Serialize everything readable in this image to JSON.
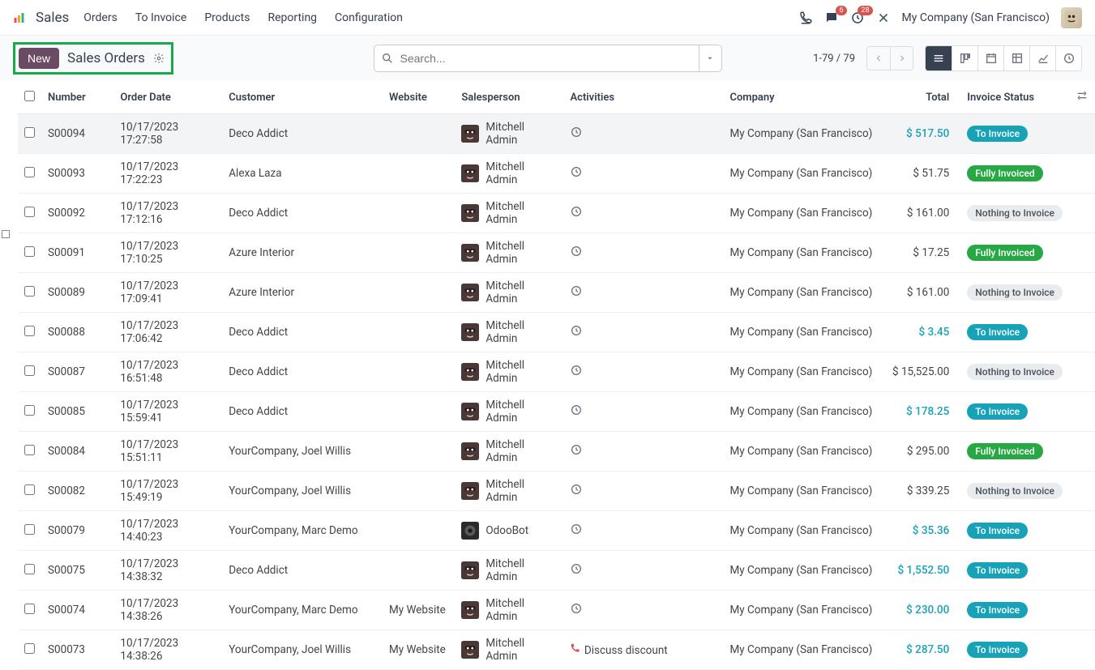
{
  "header": {
    "app_name": "Sales",
    "menu": [
      "Orders",
      "To Invoice",
      "Products",
      "Reporting",
      "Configuration"
    ],
    "msg_badge": "6",
    "activity_badge": "28",
    "company": "My Company (San Francisco)"
  },
  "controls": {
    "new_label": "New",
    "breadcrumb": "Sales Orders",
    "search_placeholder": "Search...",
    "pager": "1-79 / 79"
  },
  "columns": {
    "number": "Number",
    "order_date": "Order Date",
    "customer": "Customer",
    "website": "Website",
    "salesperson": "Salesperson",
    "activities": "Activities",
    "company": "Company",
    "total": "Total",
    "invoice_status": "Invoice Status"
  },
  "status_labels": {
    "to_invoice": "To Invoice",
    "fully": "Fully Invoiced",
    "nothing": "Nothing to Invoice"
  },
  "rows": [
    {
      "n": "S00094",
      "d": "10/17/2023 17:27:58",
      "c": "Deco Addict",
      "w": "",
      "sp": "Mitchell Admin",
      "spt": "m",
      "act": "clock",
      "actt": "",
      "co": "My Company (San Francisco)",
      "t": "$ 517.50",
      "tl": true,
      "s": "to_invoice",
      "hl": true
    },
    {
      "n": "S00093",
      "d": "10/17/2023 17:22:23",
      "c": "Alexa Laza",
      "w": "",
      "sp": "Mitchell Admin",
      "spt": "m",
      "act": "clock",
      "actt": "",
      "co": "My Company (San Francisco)",
      "t": "$ 51.75",
      "tl": false,
      "s": "fully",
      "hl": false
    },
    {
      "n": "S00092",
      "d": "10/17/2023 17:12:16",
      "c": "Deco Addict",
      "w": "",
      "sp": "Mitchell Admin",
      "spt": "m",
      "act": "clock",
      "actt": "",
      "co": "My Company (San Francisco)",
      "t": "$ 161.00",
      "tl": false,
      "s": "nothing",
      "hl": false
    },
    {
      "n": "S00091",
      "d": "10/17/2023 17:10:25",
      "c": "Azure Interior",
      "w": "",
      "sp": "Mitchell Admin",
      "spt": "m",
      "act": "clock",
      "actt": "",
      "co": "My Company (San Francisco)",
      "t": "$ 17.25",
      "tl": false,
      "s": "fully",
      "hl": false
    },
    {
      "n": "S00089",
      "d": "10/17/2023 17:09:41",
      "c": "Azure Interior",
      "w": "",
      "sp": "Mitchell Admin",
      "spt": "m",
      "act": "clock",
      "actt": "",
      "co": "My Company (San Francisco)",
      "t": "$ 161.00",
      "tl": false,
      "s": "nothing",
      "hl": false
    },
    {
      "n": "S00088",
      "d": "10/17/2023 17:06:42",
      "c": "Deco Addict",
      "w": "",
      "sp": "Mitchell Admin",
      "spt": "m",
      "act": "clock",
      "actt": "",
      "co": "My Company (San Francisco)",
      "t": "$ 3.45",
      "tl": true,
      "s": "to_invoice",
      "hl": false
    },
    {
      "n": "S00087",
      "d": "10/17/2023 16:51:48",
      "c": "Deco Addict",
      "w": "",
      "sp": "Mitchell Admin",
      "spt": "m",
      "act": "clock",
      "actt": "",
      "co": "My Company (San Francisco)",
      "t": "$ 15,525.00",
      "tl": false,
      "s": "nothing",
      "hl": false
    },
    {
      "n": "S00085",
      "d": "10/17/2023 15:59:41",
      "c": "Deco Addict",
      "w": "",
      "sp": "Mitchell Admin",
      "spt": "m",
      "act": "clock",
      "actt": "",
      "co": "My Company (San Francisco)",
      "t": "$ 178.25",
      "tl": true,
      "s": "to_invoice",
      "hl": false
    },
    {
      "n": "S00084",
      "d": "10/17/2023 15:51:11",
      "c": "YourCompany, Joel Willis",
      "w": "",
      "sp": "Mitchell Admin",
      "spt": "m",
      "act": "clock",
      "actt": "",
      "co": "My Company (San Francisco)",
      "t": "$ 295.00",
      "tl": false,
      "s": "fully",
      "hl": false
    },
    {
      "n": "S00082",
      "d": "10/17/2023 15:49:19",
      "c": "YourCompany, Joel Willis",
      "w": "",
      "sp": "Mitchell Admin",
      "spt": "m",
      "act": "clock",
      "actt": "",
      "co": "My Company (San Francisco)",
      "t": "$ 339.25",
      "tl": false,
      "s": "nothing",
      "hl": false
    },
    {
      "n": "S00079",
      "d": "10/17/2023 14:40:23",
      "c": "YourCompany, Marc Demo",
      "w": "",
      "sp": "OdooBot",
      "spt": "b",
      "act": "clock",
      "actt": "",
      "co": "My Company (San Francisco)",
      "t": "$ 35.36",
      "tl": true,
      "s": "to_invoice",
      "hl": false
    },
    {
      "n": "S00075",
      "d": "10/17/2023 14:38:32",
      "c": "Deco Addict",
      "w": "",
      "sp": "Mitchell Admin",
      "spt": "m",
      "act": "clock",
      "actt": "",
      "co": "My Company (San Francisco)",
      "t": "$ 1,552.50",
      "tl": true,
      "s": "to_invoice",
      "hl": false
    },
    {
      "n": "S00074",
      "d": "10/17/2023 14:38:26",
      "c": "YourCompany, Marc Demo",
      "w": "My Website",
      "sp": "Mitchell Admin",
      "spt": "m",
      "act": "clock",
      "actt": "",
      "co": "My Company (San Francisco)",
      "t": "$ 230.00",
      "tl": true,
      "s": "to_invoice",
      "hl": false
    },
    {
      "n": "S00073",
      "d": "10/17/2023 14:38:26",
      "c": "YourCompany, Joel Willis",
      "w": "My Website",
      "sp": "Mitchell Admin",
      "spt": "m",
      "act": "phone",
      "actt": "Discuss discount",
      "co": "My Company (San Francisco)",
      "t": "$ 287.50",
      "tl": true,
      "s": "to_invoice",
      "hl": false
    }
  ]
}
